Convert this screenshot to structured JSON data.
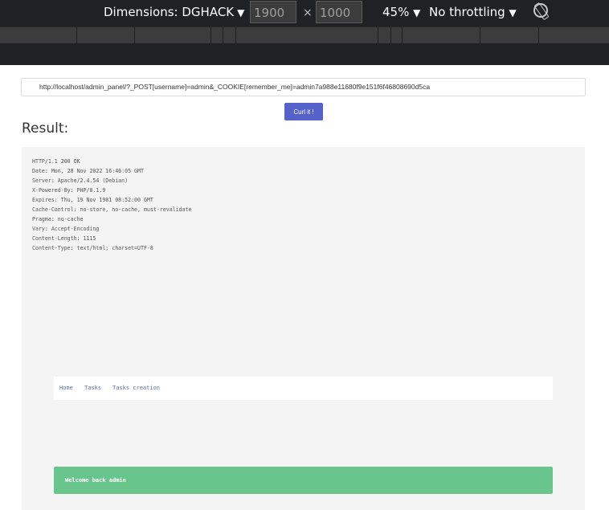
{
  "devtools": {
    "dimensions_label": "Dimensions: DGHACK",
    "width_value": "1900",
    "times": "×",
    "height_value": "1000",
    "zoom": "45%",
    "throttling": "No throttling",
    "caret": "▼"
  },
  "page": {
    "url_value": "http://localhost/admin_panel/?_POST[username]=admin&_COOKIE[remember_me]=admin7a988e11680f9e151f6f46808690d5ca",
    "curl_button": "Curl it !",
    "result_title": "Result:",
    "response_headers": [
      "HTTP/1.1 200 OK",
      "Date: Mon, 28 Nov 2022 16:46:05 GMT",
      "Server: Apache/2.4.54 (Debian)",
      "X-Powered-By: PHP/8.1.9",
      "Expires: Thu, 19 Nov 1981 08:52:00 GMT",
      "Cache-Control: no-store, no-cache, must-revalidate",
      "Pragma: no-cache",
      "Vary: Accept-Encoding",
      "Content-Length: 1115",
      "Content-Type: text/html; charset=UTF-8"
    ],
    "nav_links": [
      "Home",
      "Tasks",
      "Tasks creation"
    ],
    "alert_text": "Welcome back admin"
  }
}
